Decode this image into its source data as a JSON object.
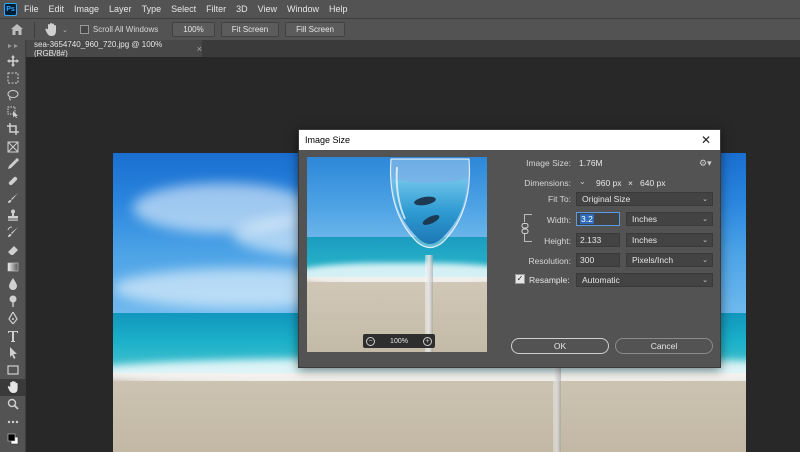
{
  "app": {
    "logo_text": "Ps"
  },
  "menu": [
    "File",
    "Edit",
    "Image",
    "Layer",
    "Type",
    "Select",
    "Filter",
    "3D",
    "View",
    "Window",
    "Help"
  ],
  "options_bar": {
    "scroll_all_label": "Scroll All Windows",
    "zoom_100_label": "100%",
    "fit_screen_label": "Fit Screen",
    "fill_screen_label": "Fill Screen"
  },
  "document_tab": {
    "title": "sea-3654740_960_720.jpg @ 100% (RGB/8#)",
    "close": "×"
  },
  "dialog": {
    "title": "Image Size",
    "close": "✕",
    "image_size_label": "Image Size:",
    "image_size_value": "1.76M",
    "dimensions_label": "Dimensions:",
    "dimensions_width": "960 px",
    "dimensions_x": "×",
    "dimensions_height": "640 px",
    "fit_to_label": "Fit To:",
    "fit_to_value": "Original Size",
    "width_label": "Width:",
    "width_value": "3.2",
    "width_unit": "Inches",
    "height_label": "Height:",
    "height_value": "2.133",
    "height_unit": "Inches",
    "resolution_label": "Resolution:",
    "resolution_value": "300",
    "resolution_unit": "Pixels/Inch",
    "resample_label": "Resample:",
    "resample_checked": true,
    "resample_value": "Automatic",
    "ok_label": "OK",
    "cancel_label": "Cancel",
    "preview_zoom": "100%"
  },
  "colors": {
    "accent_blue": "#31a8ff",
    "focus_blue": "#5a9be8",
    "panel_bg": "#535353",
    "canvas_bg": "#282828"
  }
}
